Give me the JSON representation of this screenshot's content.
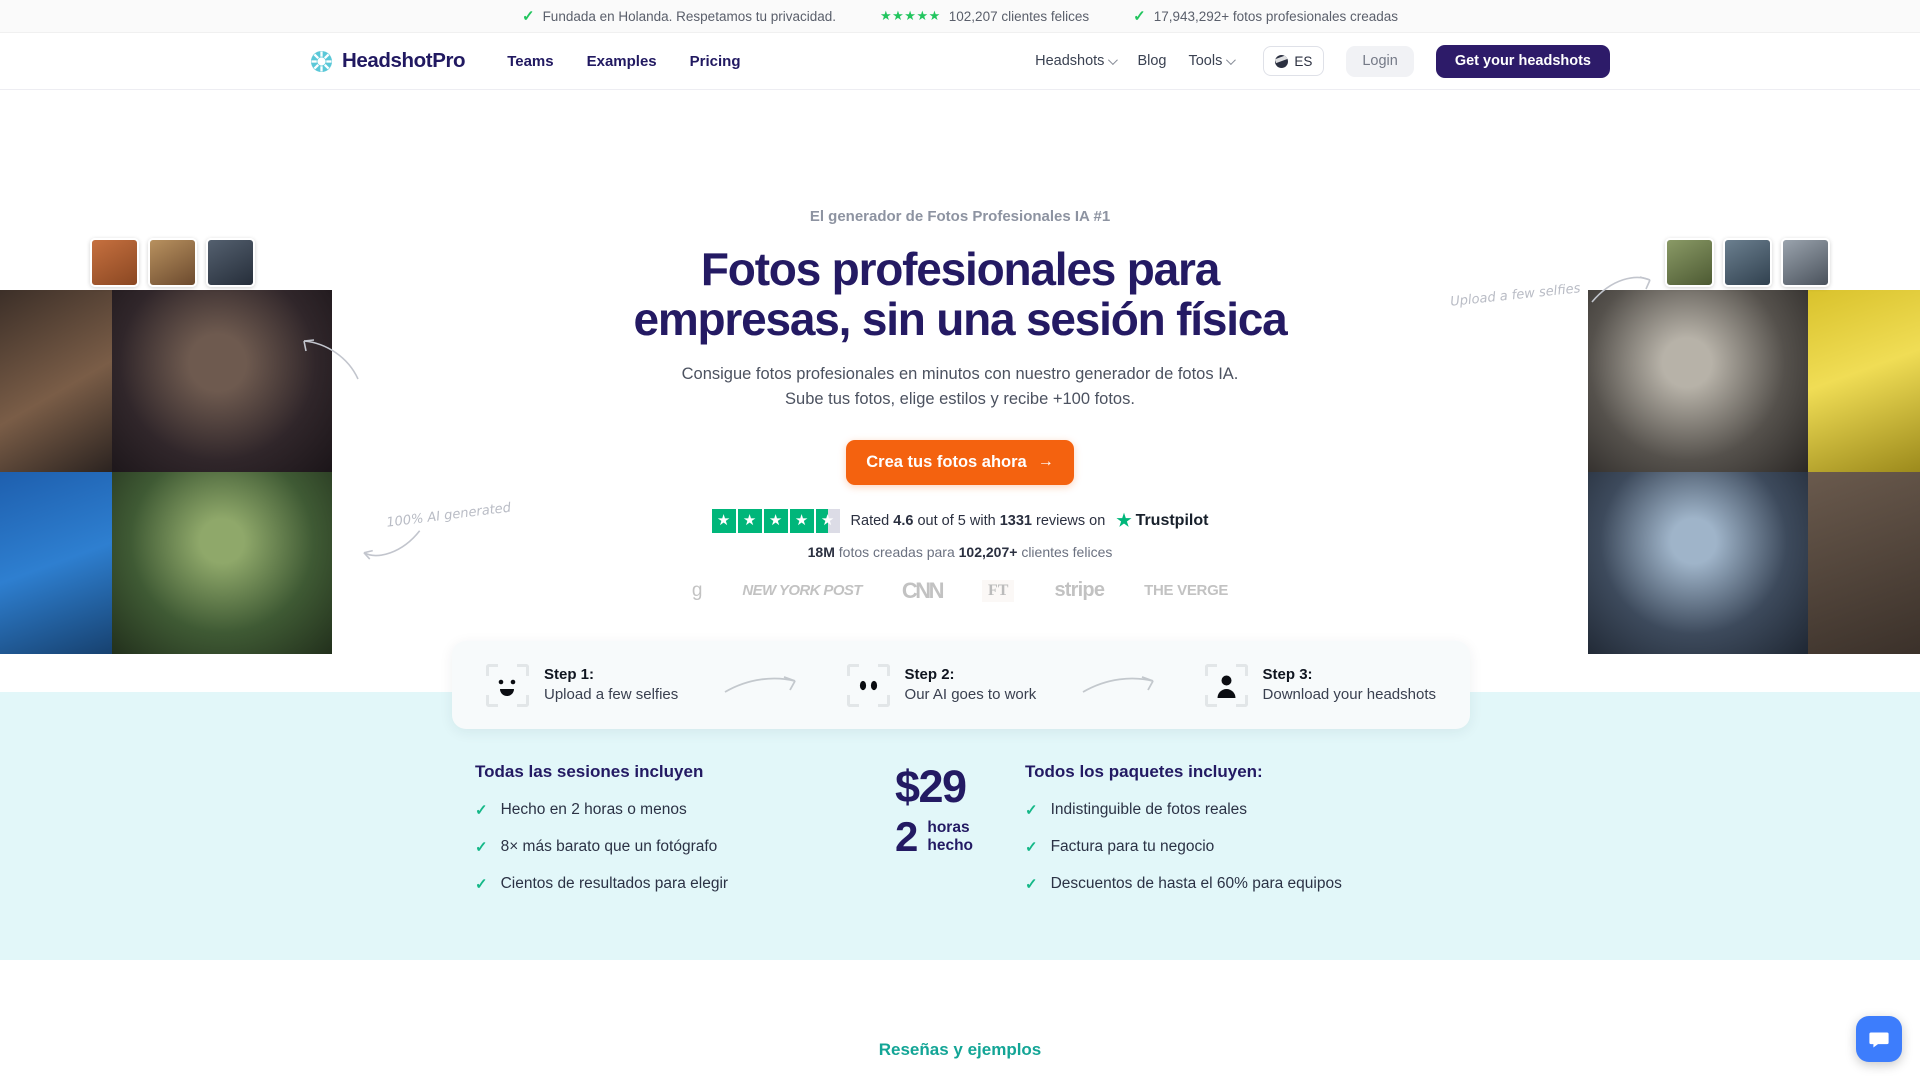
{
  "trustbar": {
    "items": [
      {
        "icon": "check-icon",
        "text": "Fundada en Holanda. Respetamos tu privacidad."
      },
      {
        "icon": "stars-icon",
        "stars": "★★★★★",
        "text": "102,207 clientes felices"
      },
      {
        "icon": "check-icon",
        "text": "17,943,292+ fotos profesionales creadas"
      }
    ]
  },
  "nav": {
    "brand": "HeadshotPro",
    "brand_icon": "aperture-logo-icon",
    "links": [
      {
        "label": "Teams"
      },
      {
        "label": "Examples"
      },
      {
        "label": "Pricing"
      }
    ],
    "right_links": [
      {
        "label": "Headshots",
        "caret": true
      },
      {
        "label": "Blog",
        "caret": false
      },
      {
        "label": "Tools",
        "caret": true
      }
    ],
    "language": "ES",
    "language_icon": "globe-icon",
    "login_label": "Login",
    "cta_label": "Get your headshots"
  },
  "hero": {
    "eyebrow": "El generador de Fotos Profesionales IA #1",
    "headline_line1": "Fotos profesionales para",
    "headline_line2": "empresas, sin una sesión física",
    "sub_line1": "Consigue fotos profesionales en minutos con nuestro generador de fotos IA.",
    "sub_line2": "Sube tus fotos, elige estilos y recibe +100 fotos.",
    "cta_label": "Crea tus fotos ahora",
    "cta_icon": "arrow-right-icon",
    "trustpilot": {
      "rating_prefix": "Rated",
      "rating": "4.6",
      "rating_mid": "out of 5 with",
      "reviews": "1331",
      "rating_suffix": "reviews on",
      "brand": "Trustpilot",
      "stars_filled": 4,
      "stars_half": 1,
      "star_color": "#00b67a"
    },
    "stat_photos": "18M",
    "stat_mid": "fotos creadas para",
    "stat_clients": "102,207+",
    "stat_suffix": "clientes felices",
    "press_logos": [
      "g",
      "NEW YORK POST",
      "CNN",
      "FT",
      "stripe",
      "THE VERGE"
    ],
    "scribble_left": "100% AI generated",
    "scribble_right": "Upload a few selfies"
  },
  "steps": [
    {
      "title": "Step 1:",
      "desc": "Upload a few selfies",
      "icon": "face-scan-icon"
    },
    {
      "title": "Step 2:",
      "desc": "Our AI goes to work",
      "icon": "eyes-scan-icon"
    },
    {
      "title": "Step 3:",
      "desc": "Download your headshots",
      "icon": "person-scan-icon"
    }
  ],
  "benefits": {
    "left_title": "Todas las sesiones incluyen",
    "left_items": [
      "Hecho en 2 horas o menos",
      "8× más barato que un fotógrafo",
      "Cientos de resultados para elegir"
    ],
    "price": "$29",
    "price_num": "2",
    "price_unit_line1": "horas",
    "price_unit_line2": "hecho",
    "right_title": "Todos los paquetes incluyen:",
    "right_items": [
      "Indistinguible de fotos reales",
      "Factura para tu negocio",
      "Descuentos de hasta el 60% para equipos"
    ],
    "check_color": "#15b888",
    "bg_color": "#e2f7f9"
  },
  "reviews_heading": "Reseñas y ejemplos",
  "chat": {
    "icon": "chat-bubble-icon",
    "color": "#3d7dfc"
  }
}
